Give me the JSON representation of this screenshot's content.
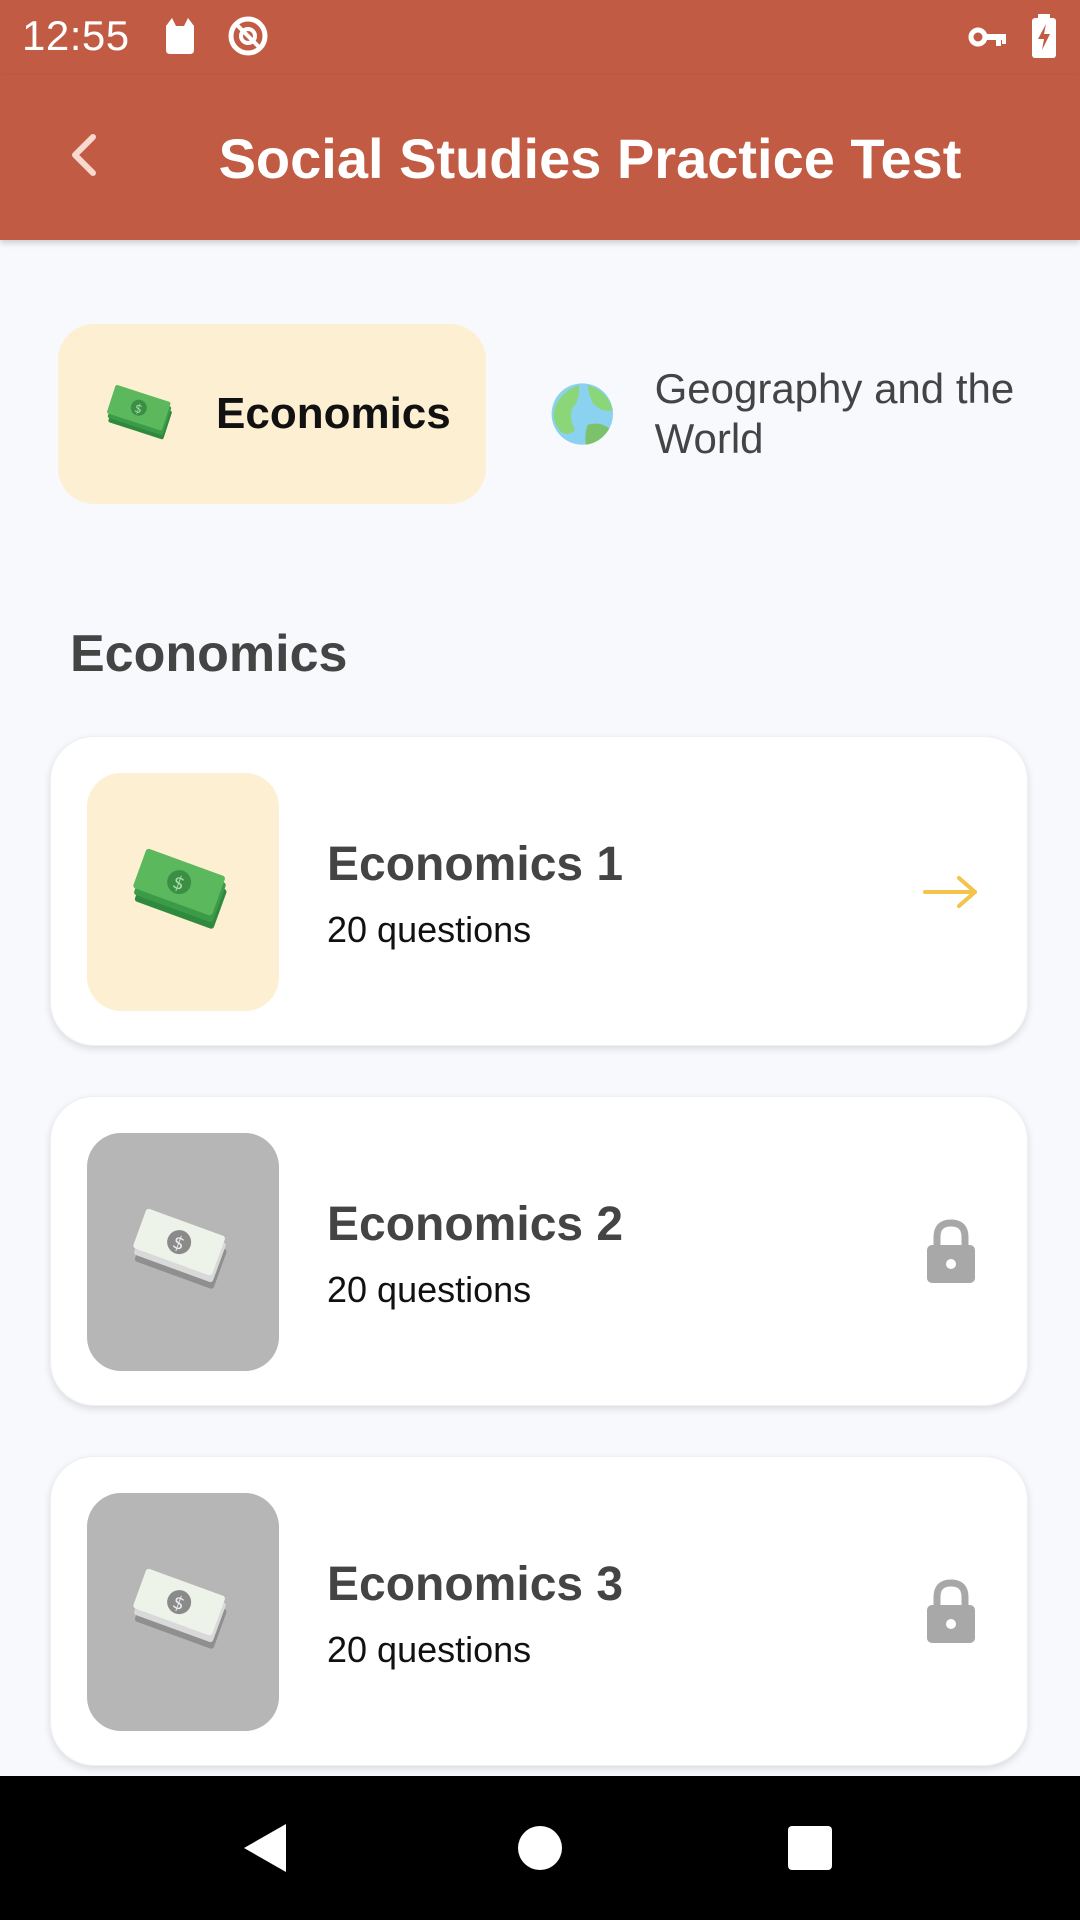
{
  "status_bar": {
    "time": "12:55"
  },
  "app_bar": {
    "title": "Social Studies Practice Test"
  },
  "categories": [
    {
      "label": "Economics",
      "selected": true
    },
    {
      "label": "Geography and the World",
      "selected": false
    }
  ],
  "section": {
    "title": "Economics"
  },
  "tests": [
    {
      "title": "Economics 1",
      "subtitle": "20 questions",
      "locked": false
    },
    {
      "title": "Economics 2",
      "subtitle": "20 questions",
      "locked": true
    },
    {
      "title": "Economics 3",
      "subtitle": "20 questions",
      "locked": true
    }
  ],
  "colors": {
    "primary": "#c25b43",
    "chip_selected": "#fdf0d2",
    "arrow": "#f3c34b",
    "lock": "#a8a8a8",
    "locked_thumb": "#b6b6b6"
  }
}
